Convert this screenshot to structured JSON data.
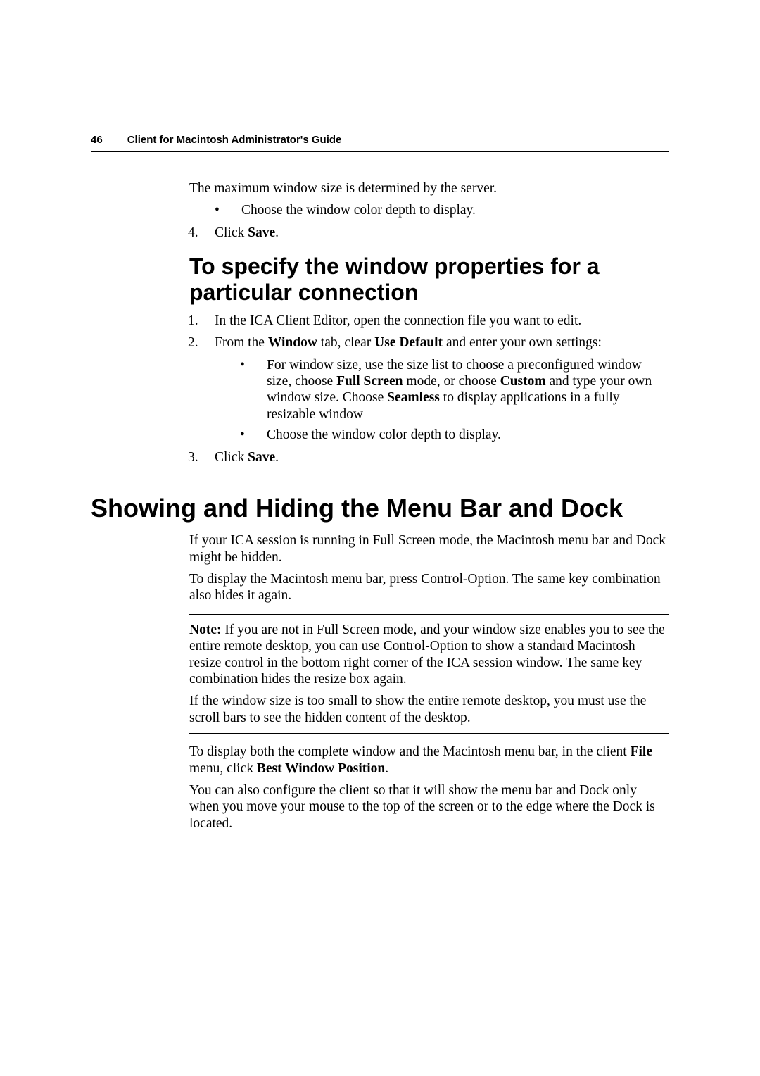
{
  "header": {
    "page_number": "46",
    "title": "Client for Macintosh Administrator's Guide"
  },
  "chart_data": null,
  "sectionA": {
    "line1": "The maximum window size is determined by the server.",
    "bullet1": "Choose the window color depth to display.",
    "step4_num": "4.",
    "step4_a": "Click ",
    "step4_b": "Save",
    "step4_c": "."
  },
  "heading2": "To specify the window properties for a particular connection",
  "sectionB": {
    "s1_num": "1.",
    "s1": "In the ICA Client Editor, open the connection file you want to edit.",
    "s2_num": "2.",
    "s2_a": "From the ",
    "s2_b": "Window",
    "s2_c": " tab, clear ",
    "s2_d": "Use Default",
    "s2_e": " and enter your own settings:",
    "b1_a": "For window size, use the size list to choose a preconfigured window size, choose ",
    "b1_b": "Full Screen",
    "b1_c": " mode, or choose ",
    "b1_d": "Custom",
    "b1_e": " and type your own window size. Choose ",
    "b1_f": "Seamless",
    "b1_g": " to display applications in a fully resizable window",
    "b2": "Choose the window color depth to display.",
    "s3_num": "3.",
    "s3_a": "Click ",
    "s3_b": "Save",
    "s3_c": "."
  },
  "heading1": "Showing and Hiding the Menu Bar and Dock",
  "sectionC": {
    "p1": "If your ICA session is running in Full Screen mode, the Macintosh menu bar and Dock might be hidden.",
    "p2": "To display the Macintosh menu bar, press Control-Option. The same key combination also hides it again.",
    "note1_a": "Note:",
    "note1_b": "   If you are not in Full Screen mode, and your window size enables you to see the entire remote desktop, you can use Control-Option to show a standard Macintosh resize control in the bottom right corner of the ICA session window. The same key combination hides the resize box again.",
    "note2": "If the window size is too small to show the entire remote desktop, you must use the scroll bars to see the hidden content of the desktop.",
    "p3_a": "To display both the complete window and the Macintosh menu bar, in the client ",
    "p3_b": "File",
    "p3_c": " menu, click ",
    "p3_d": "Best Window Position",
    "p3_e": ".",
    "p4": "You can also configure the client so that it will show the menu bar and Dock only when you move your mouse to the top of the screen or to the edge where the Dock is located."
  }
}
